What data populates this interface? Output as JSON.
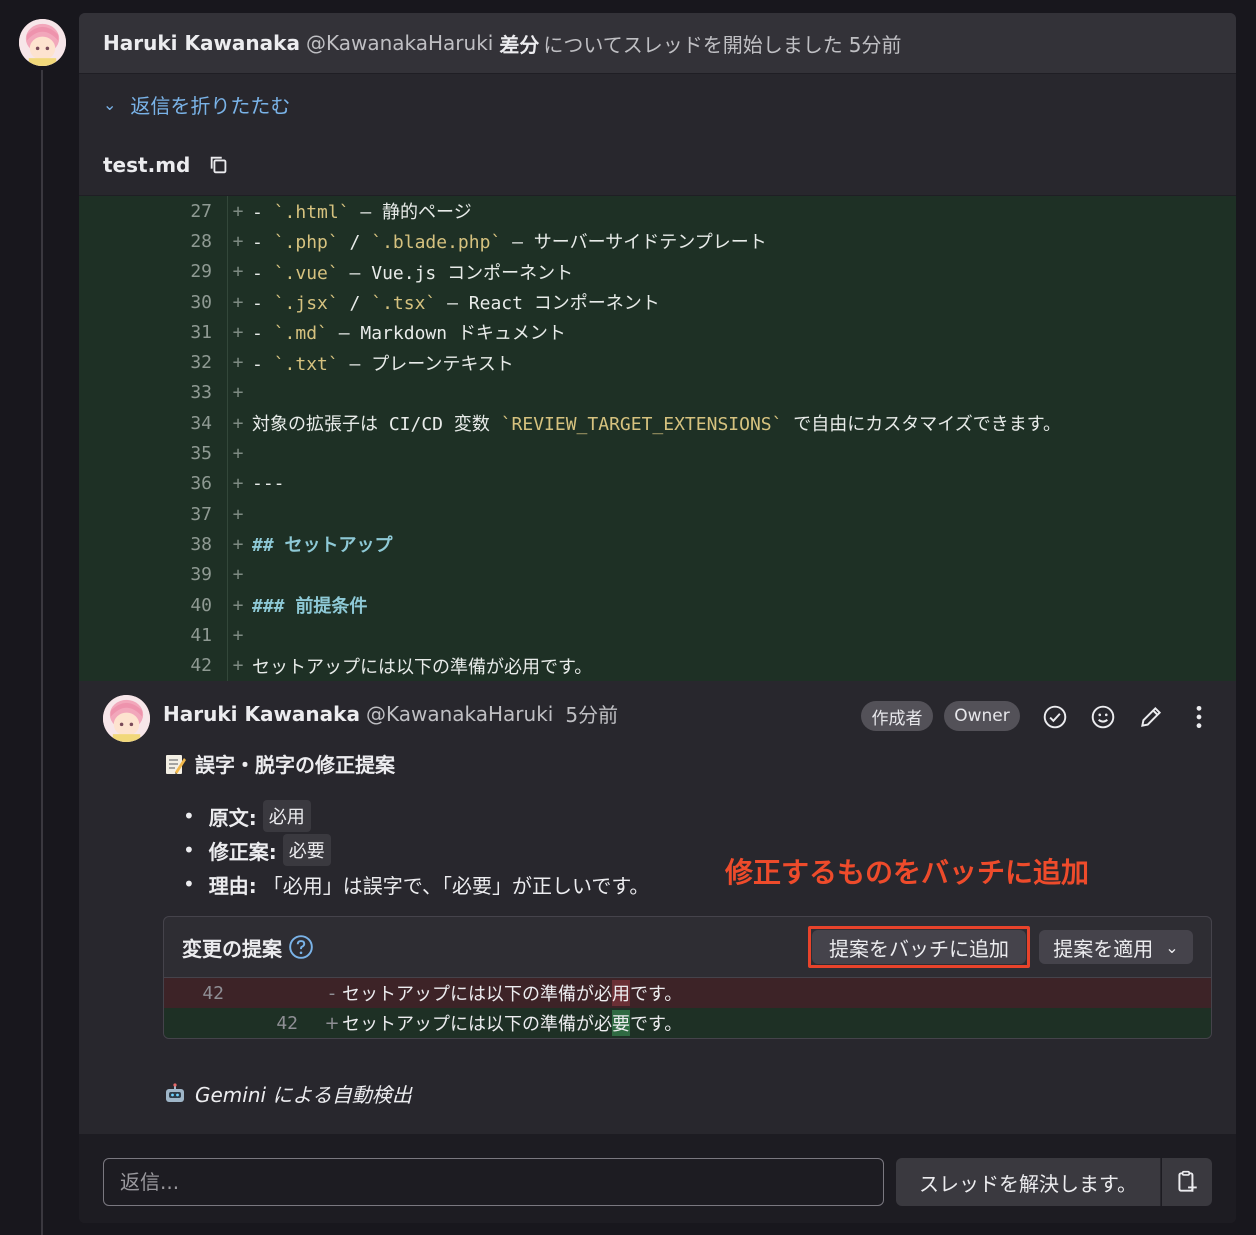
{
  "thread": {
    "header": {
      "author": "Haruki Kawanaka",
      "handle": "@KawanakaHaruki",
      "target": "差分",
      "action": "についてスレッドを開始しました",
      "time": "5分前"
    },
    "collapse_label": "返信を折りたたむ",
    "file_name": "test.md",
    "diff_lines": [
      {
        "n": "27",
        "text": "- `.html` — 静的ページ"
      },
      {
        "n": "28",
        "text": "- `.php` / `.blade.php` — サーバーサイドテンプレート"
      },
      {
        "n": "29",
        "text": "- `.vue` — Vue.js コンポーネント"
      },
      {
        "n": "30",
        "text": "- `.jsx` / `.tsx` — React コンポーネント"
      },
      {
        "n": "31",
        "text": "- `.md` — Markdown ドキュメント"
      },
      {
        "n": "32",
        "text": "- `.txt` — プレーンテキスト"
      },
      {
        "n": "33",
        "text": ""
      },
      {
        "n": "34",
        "text": "対象の拡張子は CI/CD 変数 `REVIEW_TARGET_EXTENSIONS` で自由にカスタマイズできます。"
      },
      {
        "n": "35",
        "text": ""
      },
      {
        "n": "36",
        "text": "---"
      },
      {
        "n": "37",
        "text": ""
      },
      {
        "n": "38",
        "text": "## セットアップ"
      },
      {
        "n": "39",
        "text": ""
      },
      {
        "n": "40",
        "text": "### 前提条件"
      },
      {
        "n": "41",
        "text": ""
      },
      {
        "n": "42",
        "text": "セットアップには以下の準備が必用です。"
      }
    ],
    "plus_sign": "+"
  },
  "comment": {
    "author": "Haruki Kawanaka",
    "handle": "@KawanakaHaruki",
    "time": "5分前",
    "badge_author": "作成者",
    "badge_role": "Owner",
    "title": "誤字・脱字の修正提案",
    "items": [
      {
        "key": "原文:",
        "value": "必用"
      },
      {
        "key": "修正案:",
        "value": "必要"
      },
      {
        "key": "理由:",
        "value": "「必用」は誤字で、「必要」が正しいです。"
      }
    ],
    "annotation": "修正するものをバッチに追加",
    "suggestion": {
      "title": "変更の提案",
      "add_batch_label": "提案をバッチに追加",
      "apply_label": "提案を適用",
      "apply_chevron": "⌄",
      "old": {
        "n": "42",
        "mark": "-",
        "before": "セットアップには以下の準備が必",
        "changed": "用",
        "after": "です。"
      },
      "new": {
        "n": "42",
        "mark": "+",
        "before": "セットアップには以下の準備が必",
        "changed": "要",
        "after": "です。"
      }
    },
    "footer": "Gemini による自動検出"
  },
  "reply": {
    "placeholder": "返信...",
    "resolve_label": "スレッドを解決します。"
  },
  "colors": {
    "accent_link": "#7ab3e8",
    "annotation_red": "#ee4b2b",
    "diff_add_bg": "#1e3025",
    "diff_del_bg": "#3d2327"
  }
}
